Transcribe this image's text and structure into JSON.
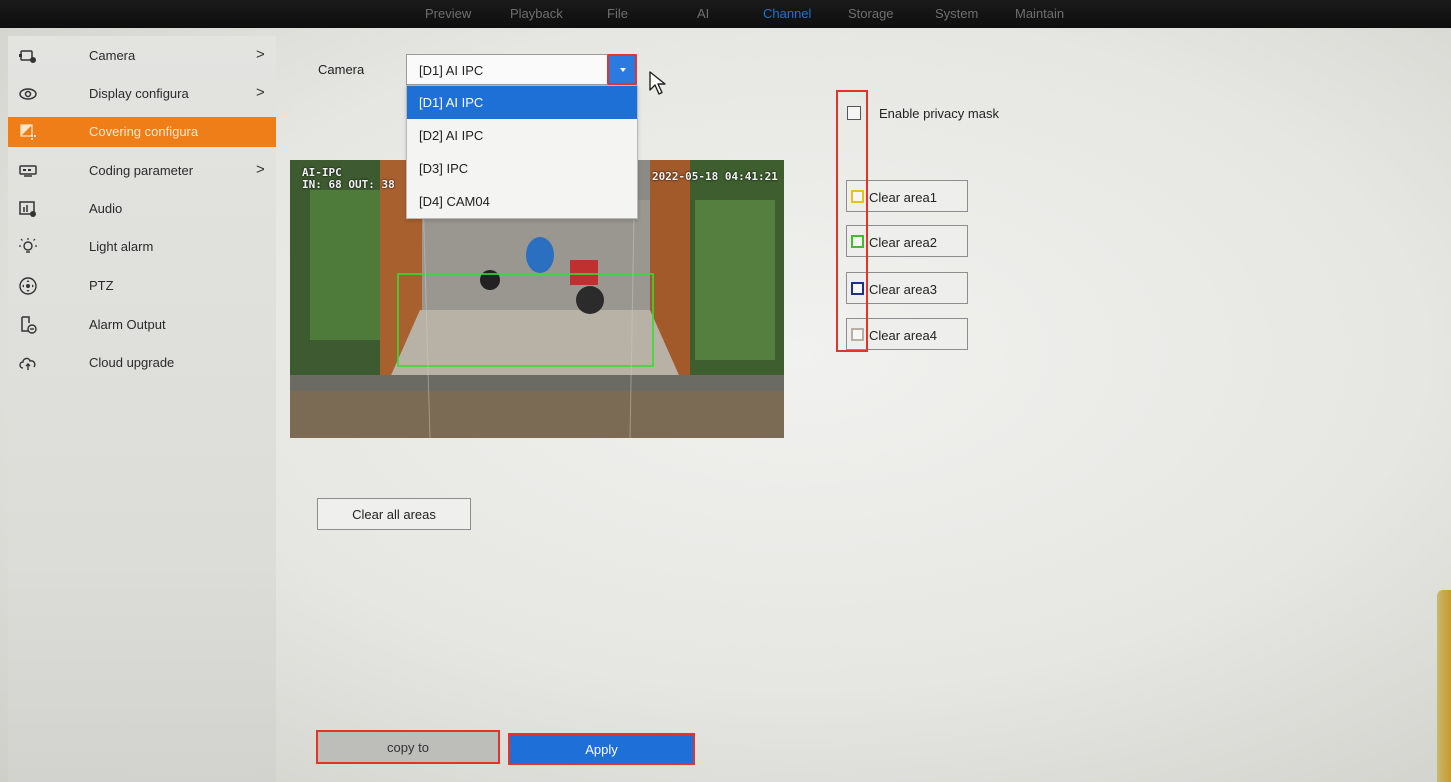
{
  "topnav": {
    "tabs": [
      {
        "label": "Preview"
      },
      {
        "label": "Playback"
      },
      {
        "label": "File"
      },
      {
        "label": "AI"
      },
      {
        "label": "Channel"
      },
      {
        "label": "Storage"
      },
      {
        "label": "System"
      },
      {
        "label": "Maintain"
      }
    ],
    "active_tab": "Channel"
  },
  "sidebar": {
    "items": [
      {
        "label": "Camera",
        "icon": "camera-icon",
        "chevron": ">"
      },
      {
        "label": "Display configura",
        "icon": "eye-icon",
        "chevron": ">"
      },
      {
        "label": "Covering configura",
        "icon": "covering-icon",
        "selected": true
      },
      {
        "label": "Coding parameter",
        "icon": "coding-icon",
        "chevron": ">"
      },
      {
        "label": "Audio",
        "icon": "audio-icon"
      },
      {
        "label": "Light alarm",
        "icon": "light-bulb-icon"
      },
      {
        "label": "PTZ",
        "icon": "ptz-icon"
      },
      {
        "label": "Alarm Output",
        "icon": "alarm-output-icon"
      },
      {
        "label": "Cloud upgrade",
        "icon": "cloud-upgrade-icon"
      }
    ]
  },
  "camera_field": {
    "label": "Camera",
    "selected_value": "[D1] AI IPC",
    "options": [
      "[D1] AI IPC",
      "[D2] AI IPC",
      "[D3] IPC",
      "[D4] CAM04"
    ]
  },
  "preview": {
    "osd_top_left_line1": "AI-IPC",
    "osd_top_left_line2": "IN: 68 OUT: 38",
    "osd_timestamp": "2022-05-18 04:41:21"
  },
  "privacy": {
    "enable_label": "Enable privacy mask",
    "enabled": false
  },
  "areas": [
    {
      "label": "Clear area1",
      "color": "#e8c21a"
    },
    {
      "label": "Clear area2",
      "color": "#3fbf2a"
    },
    {
      "label": "Clear area3",
      "color": "#1f2f8f"
    },
    {
      "label": "Clear area4",
      "color": "#b8b0a6"
    }
  ],
  "buttons": {
    "clear_all": "Clear all areas",
    "copy_to": "copy to",
    "apply": "Apply"
  },
  "colors": {
    "accent": "#1f6fd9",
    "selected_menu": "#f07e18",
    "highlight": "#e6332a"
  }
}
